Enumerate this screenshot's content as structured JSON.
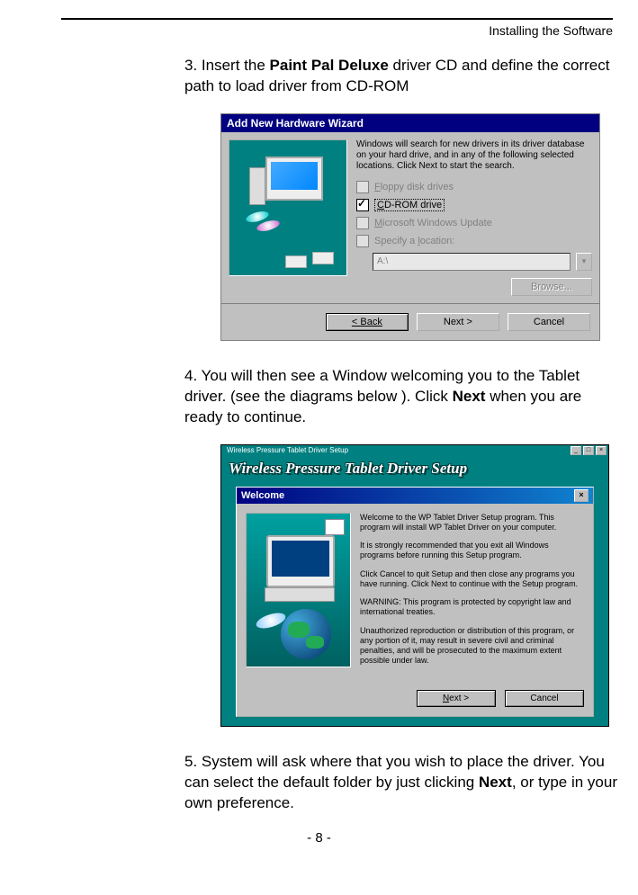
{
  "header": {
    "section": "Installing the Software"
  },
  "step3": {
    "num": "3.",
    "text_a": "Insert the ",
    "bold": "Paint Pal Deluxe",
    "text_b": " driver CD and define the correct path to load driver from CD-ROM"
  },
  "wizard1": {
    "title": "Add New Hardware Wizard",
    "intro": "Windows will search for new drivers in its driver database on your hard drive, and in any of the following selected locations. Click Next to start the search.",
    "opt_floppy_pre": "F",
    "opt_floppy": "loppy disk drives",
    "opt_cdrom_pre": "C",
    "opt_cdrom": "D-ROM drive",
    "opt_update_pre": "M",
    "opt_update": "icrosoft Windows Update",
    "opt_location": "Specify a ",
    "opt_location_u": "l",
    "opt_location_post": "ocation:",
    "location_value": "A:\\",
    "browse": "Browse...",
    "back": "< Back",
    "next": "Next >",
    "cancel": "Cancel"
  },
  "step4": {
    "num": "4.",
    "text_a": "You will then see a Window welcoming you to the Tablet driver. (see the diagrams below ).  Click ",
    "bold": "Next",
    "text_b": " when you are ready to continue."
  },
  "wizard2": {
    "topbar": "Wireless Pressure Tablet Driver Setup",
    "title": "Wireless Pressure Tablet  Driver Setup",
    "inner_title": "Welcome",
    "p1": "Welcome to the WP Tablet Driver Setup program. This program will install WP Tablet Driver on your computer.",
    "p2": "It is strongly recommended that you exit all Windows programs before running this Setup program.",
    "p3": "Click Cancel to quit Setup and then close any programs you have running. Click Next to continue with the Setup program.",
    "p4": "WARNING: This program is protected by copyright law and international treaties.",
    "p5": "Unauthorized reproduction or distribution of this program, or any portion of it, may result in severe civil and criminal penalties, and will be prosecuted to the maximum extent possible under law.",
    "next": "Next >",
    "cancel": "Cancel"
  },
  "step5": {
    "num": "5.",
    "text_a": "System will ask where that you wish to place the driver. You can select the default folder by just clicking ",
    "bold": "Next",
    "text_b": ", or type in your own preference."
  },
  "page_number": "- 8 -"
}
